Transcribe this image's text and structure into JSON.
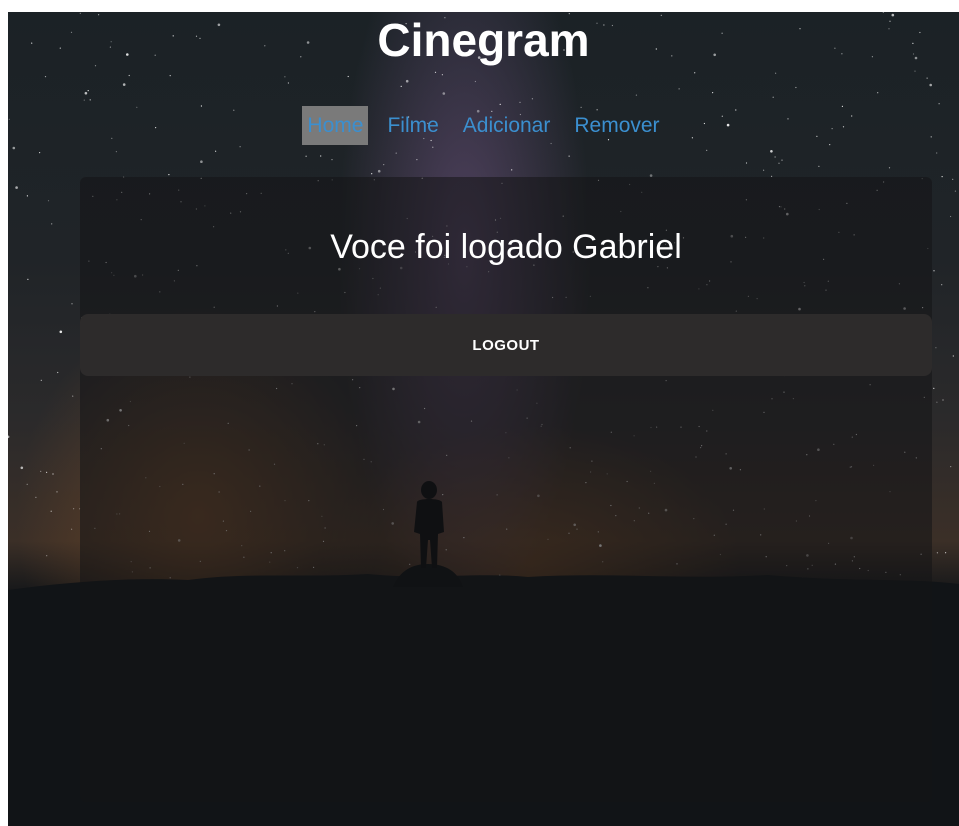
{
  "header": {
    "title": "Cinegram"
  },
  "nav": {
    "items": [
      {
        "label": "Home",
        "active": true
      },
      {
        "label": "Filme",
        "active": false
      },
      {
        "label": "Adicionar",
        "active": false
      },
      {
        "label": "Remover",
        "active": false
      }
    ]
  },
  "main": {
    "welcome_text": "Voce foi logado Gabriel",
    "logout_label": "LOGOUT"
  },
  "colors": {
    "nav_link": "#3b8fcf",
    "nav_active_bg": "#7a7a7a",
    "button_bg": "#2d2b2b",
    "text": "#ffffff"
  },
  "background": {
    "description_icon": "starry-night-background"
  }
}
